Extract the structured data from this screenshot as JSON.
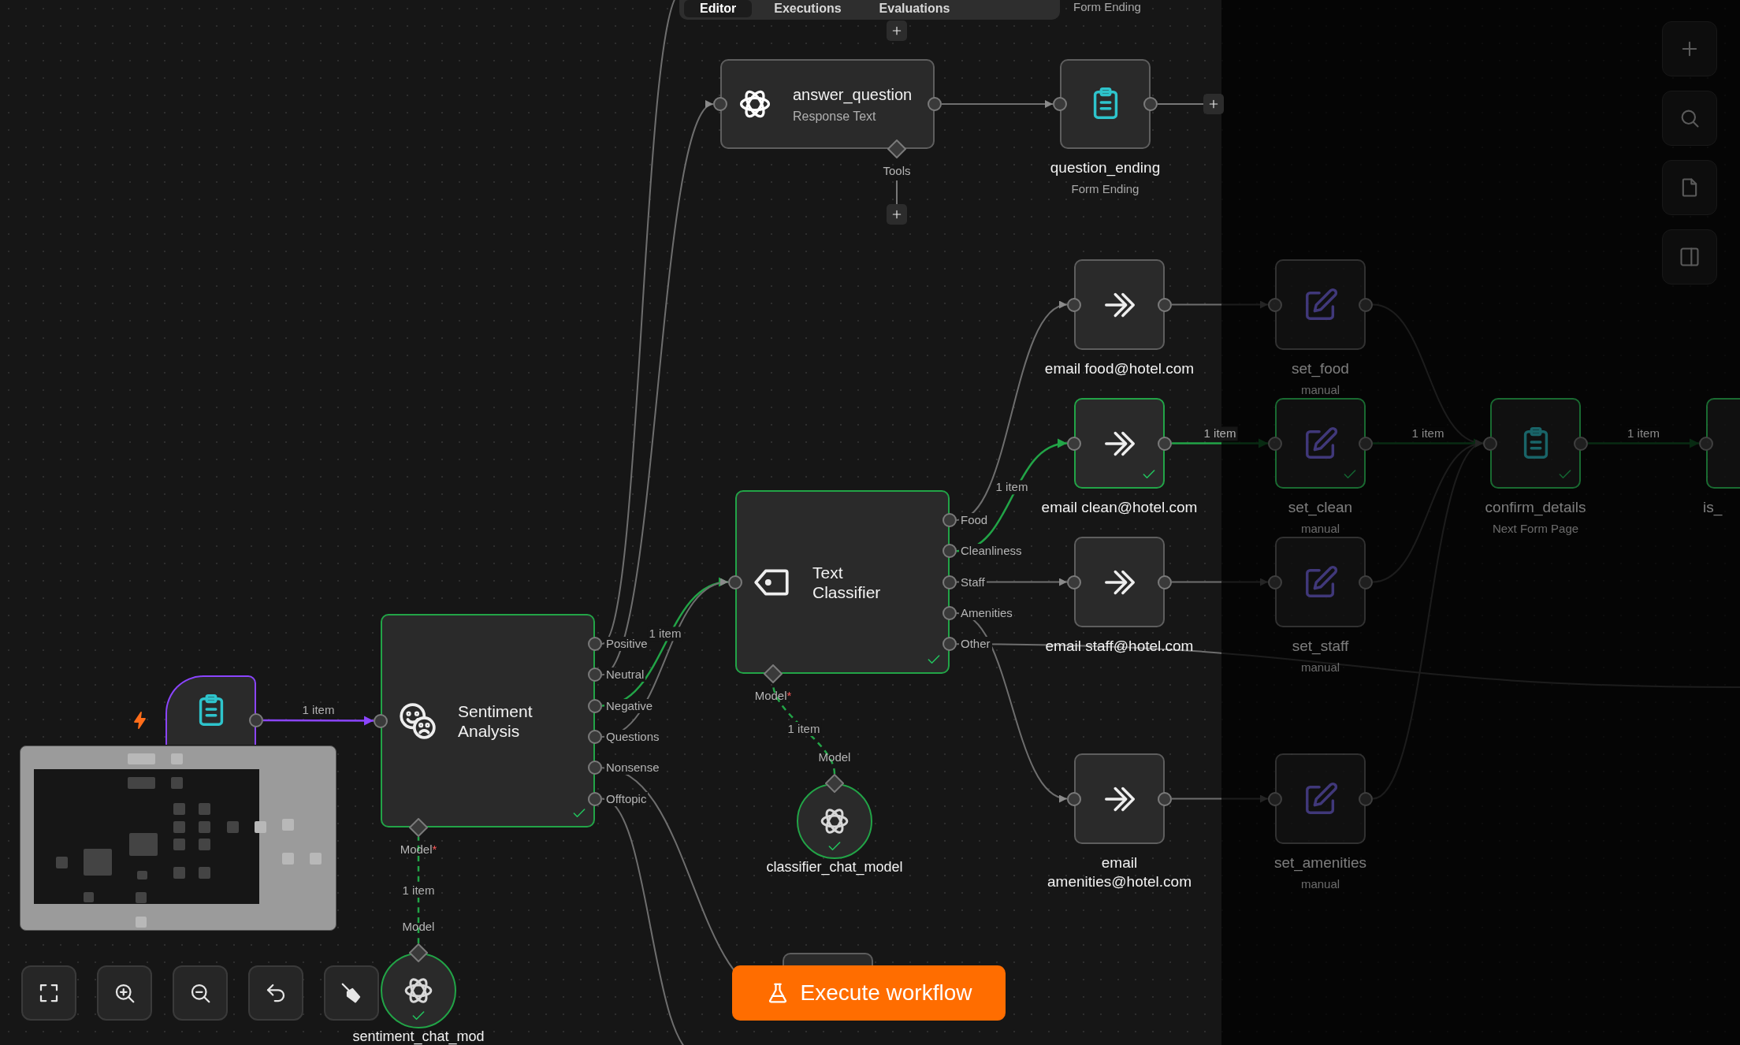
{
  "tabs": [
    {
      "label": "Editor",
      "selected": true
    },
    {
      "label": "Executions",
      "selected": false
    },
    {
      "label": "Evaluations",
      "selected": false
    }
  ],
  "partial_node": {
    "subtitle": "Form Ending"
  },
  "nodes": [
    {
      "kind": "trigger",
      "selected": true,
      "success": false,
      "dimmed": false,
      "items": "1 item"
    },
    {
      "kind": "sentiment",
      "title": "Sentiment Analysis",
      "selected": false,
      "success": true,
      "dimmed": false,
      "outputs": [
        {
          "label": "Positive"
        },
        {
          "label": "Neutral"
        },
        {
          "label": "Negative",
          "items": "1 item"
        },
        {
          "label": "Questions"
        },
        {
          "label": "Nonsense"
        },
        {
          "label": "Offtopic"
        }
      ],
      "sub_ports": [
        {
          "label": "Model",
          "required_mark": "*"
        }
      ]
    },
    {
      "kind": "model",
      "title": "sentiment_chat_mod",
      "selected": false,
      "success": true,
      "dimmed": false,
      "items": "1 item",
      "sub_ports": [
        {
          "label": "Model"
        }
      ]
    },
    {
      "kind": "llm",
      "title": "answer_question",
      "subtitle": "Response Text",
      "selected": false,
      "success": false,
      "dimmed": false,
      "sub_ports": [
        {
          "label": "Tools",
          "add": true
        }
      ]
    },
    {
      "kind": "classifier",
      "title": "Text Classifier",
      "selected": false,
      "success": true,
      "dimmed": false,
      "outputs": [
        {
          "label": "Food"
        },
        {
          "label": "Cleanliness",
          "items": "1 item"
        },
        {
          "label": "Staff"
        },
        {
          "label": "Amenities"
        },
        {
          "label": "Other"
        }
      ],
      "sub_ports": [
        {
          "label": "Model",
          "required_mark": "*"
        }
      ]
    },
    {
      "kind": "model",
      "title": "classifier_chat_model",
      "selected": false,
      "success": true,
      "dimmed": false,
      "items": "1 item",
      "sub_ports": [
        {
          "label": "Model"
        }
      ]
    },
    {
      "kind": "form",
      "title": "question_ending",
      "subtitle": "Form Ending",
      "selected": false,
      "success": false,
      "dimmed": false,
      "add_output": true
    },
    {
      "kind": "send",
      "title": "email food@hotel.com",
      "selected": false,
      "success": false,
      "dimmed": false
    },
    {
      "kind": "send",
      "title": "email clean@hotel.com",
      "selected": false,
      "success": true,
      "dimmed": false,
      "items": "1 item"
    },
    {
      "kind": "send",
      "title": "email staff@hotel.com",
      "selected": false,
      "success": false,
      "dimmed": false
    },
    {
      "kind": "send",
      "title": "email amenities@hotel.com",
      "selected": false,
      "success": false,
      "dimmed": false
    },
    {
      "kind": "edit",
      "title": "set_food",
      "subtitle": "manual",
      "selected": false,
      "success": false,
      "dimmed": true
    },
    {
      "kind": "edit",
      "title": "set_clean",
      "subtitle": "manual",
      "selected": false,
      "success": true,
      "dimmed": true,
      "items": "1 item"
    },
    {
      "kind": "edit",
      "title": "set_staff",
      "subtitle": "manual",
      "selected": false,
      "success": false,
      "dimmed": true
    },
    {
      "kind": "edit",
      "title": "set_amenities",
      "subtitle": "manual",
      "selected": false,
      "success": false,
      "dimmed": true
    },
    {
      "kind": "form",
      "title": "confirm_details",
      "subtitle": "Next Form Page",
      "selected": false,
      "success": true,
      "dimmed": true,
      "items": "1 item"
    },
    {
      "kind": "blank",
      "title": "is_",
      "selected": false,
      "success": true,
      "dimmed": true
    }
  ],
  "execute_button": {
    "label": "Execute workflow"
  },
  "canvas_controls": [
    {
      "kind": "fit"
    },
    {
      "kind": "zoom_in"
    },
    {
      "kind": "zoom_out"
    },
    {
      "kind": "undo"
    },
    {
      "kind": "tidy"
    }
  ],
  "right_toolbar": [
    {
      "kind": "add"
    },
    {
      "kind": "search"
    },
    {
      "kind": "sticky"
    },
    {
      "kind": "panel"
    }
  ]
}
